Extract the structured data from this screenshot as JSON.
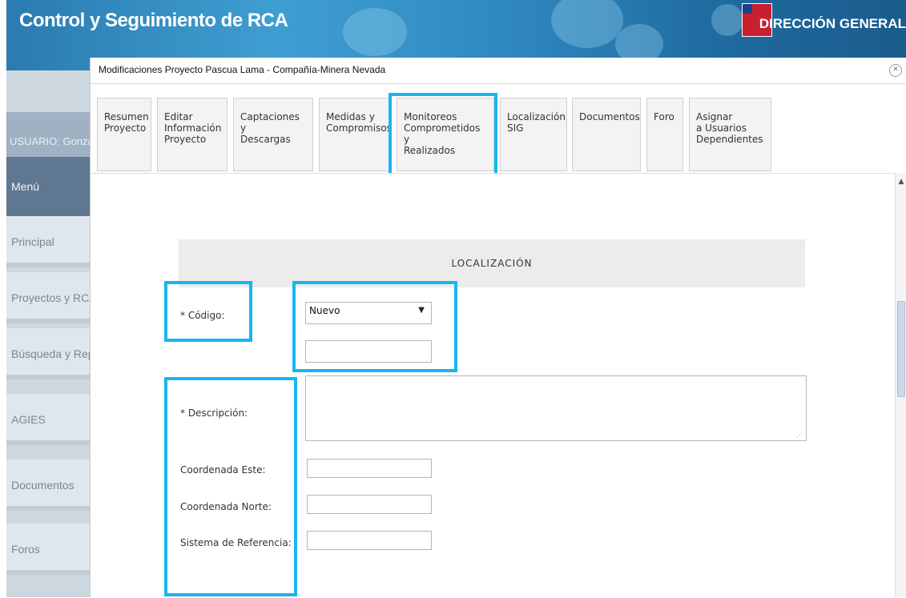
{
  "banner": {
    "app_title": "Control y Seguimiento de RCA",
    "dir_title": "DIRECCIÓN GENERAL"
  },
  "sidebar": {
    "user_label": "USUARIO: Gonza",
    "menu_label": "Menú",
    "items": [
      {
        "label": "Principal"
      },
      {
        "label": "Proyectos y RCA"
      },
      {
        "label": "Búsqueda y Rep"
      },
      {
        "label": "AGIES"
      },
      {
        "label": "Documentos"
      },
      {
        "label": "Foros"
      }
    ]
  },
  "modal": {
    "title": "Modificaciones Proyecto Pascua Lama - Compañía-Minera Nevada",
    "close_icon": "close-icon",
    "tabs": [
      {
        "label": "Resumen\nProyecto"
      },
      {
        "label": "Editar\nInformación\nProyecto"
      },
      {
        "label": "Captaciones y\nDescargas"
      },
      {
        "label": "Medidas y\nCompromisos"
      },
      {
        "label": "Monitoreos\nComprometidos y\nRealizados"
      },
      {
        "label": "Localización\nSIG"
      },
      {
        "label": "Documentos"
      },
      {
        "label": "Foro"
      },
      {
        "label": "Asignar\na Usuarios\nDependientes"
      }
    ]
  },
  "form": {
    "section_title": "LOCALIZACIÓN",
    "codigo_label": "* Código:",
    "codigo_select_value": "Nuevo",
    "codigo_text_value": "",
    "descripcion_label": "* Descripción:",
    "descripcion_value": "",
    "este_label": "Coordenada Este:",
    "este_value": "",
    "norte_label": "Coordenada Norte:",
    "norte_value": "",
    "sistema_label": "Sistema de Referencia:",
    "sistema_value": ""
  },
  "colors": {
    "highlight": "#18b5f0",
    "banner": "#2f89c0",
    "menu_active": "#5f7790"
  }
}
